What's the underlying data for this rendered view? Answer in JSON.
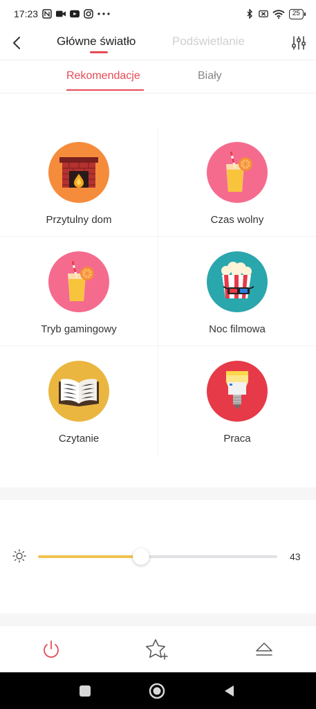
{
  "status_bar": {
    "time": "17:23",
    "left_icons": [
      "nfc-icon",
      "video-call-icon",
      "youtube-icon",
      "instagram-icon",
      "more-dots-icon"
    ],
    "right_icons": [
      "bluetooth-icon",
      "no-sim-icon",
      "wifi-icon"
    ],
    "battery": "25"
  },
  "nav": {
    "tabs": [
      {
        "label": "Główne światło",
        "active": true
      },
      {
        "label": "Podświetlanie",
        "active": false
      }
    ]
  },
  "sub_tabs": [
    {
      "label": "Rekomendacje",
      "active": true
    },
    {
      "label": "Biały",
      "active": false
    }
  ],
  "scenes": [
    {
      "label": "Przytulny dom",
      "icon": "fireplace-icon",
      "color": "#f58c3c"
    },
    {
      "label": "Czas wolny",
      "icon": "juice-icon",
      "color": "#f56b8e"
    },
    {
      "label": "Tryb gamingowy",
      "icon": "juice-icon",
      "color": "#f56b8e"
    },
    {
      "label": "Noc filmowa",
      "icon": "popcorn-icon",
      "color": "#2aa6ad"
    },
    {
      "label": "Czytanie",
      "icon": "book-icon",
      "color": "#eab640"
    },
    {
      "label": "Praca",
      "icon": "bulb-icon",
      "color": "#e63a48"
    }
  ],
  "brightness": {
    "value": "43",
    "fraction": 0.43,
    "fill_color": "#f2c24f"
  },
  "bottom_bar": {
    "buttons": [
      "power-icon",
      "star-add-icon",
      "eject-icon"
    ],
    "accent": "#e64a55"
  }
}
